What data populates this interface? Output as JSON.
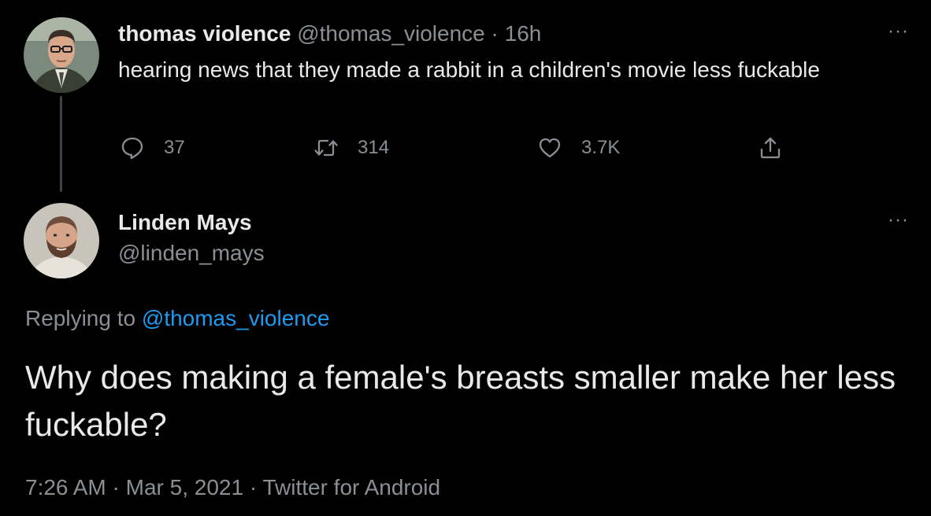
{
  "parent_tweet": {
    "display_name": "thomas violence",
    "handle": "@thomas_violence",
    "separator": "·",
    "time": "16h",
    "text": "hearing news that they made a rabbit in a children's movie less fuckable",
    "more_label": "···",
    "actions": {
      "reply_count": "37",
      "retweet_count": "314",
      "like_count": "3.7K"
    }
  },
  "reply_tweet": {
    "display_name": "Linden Mays",
    "handle": "@linden_mays",
    "more_label": "···",
    "replying_prefix": "Replying to",
    "replying_handle": "@thomas_violence",
    "text": "Why does making a female's breasts smaller make her less fuckable?",
    "timestamp_time": "7:26 AM",
    "timestamp_date": "Mar 5, 2021",
    "source": "Twitter for Android",
    "separator": "·"
  },
  "colors": {
    "background": "#000000",
    "primary_text": "#e7e9ea",
    "secondary_text": "#8b8f94",
    "link": "#1d9bf0",
    "thread_line": "#3d4248"
  }
}
